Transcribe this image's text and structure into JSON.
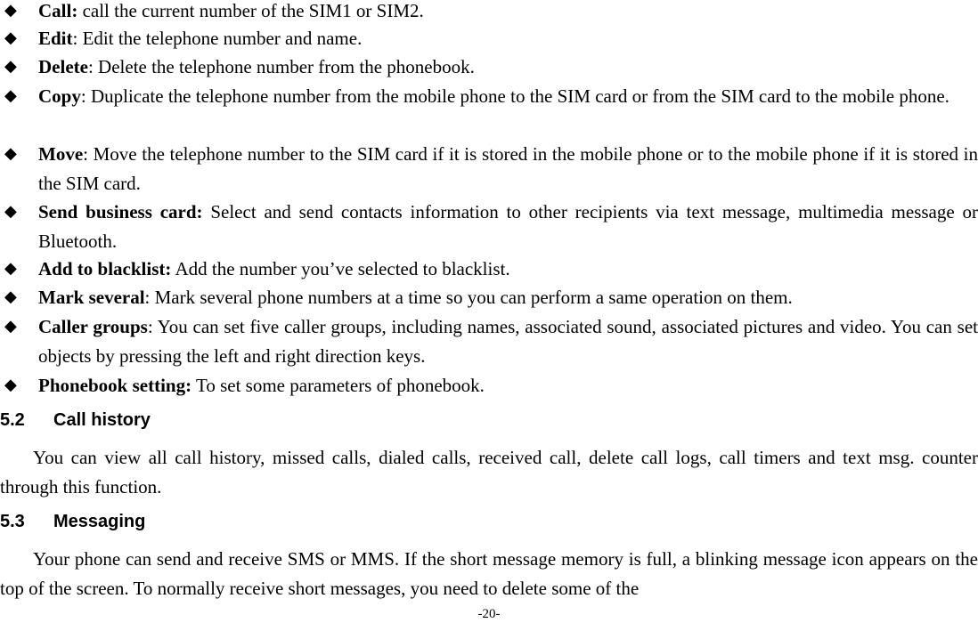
{
  "bullets": [
    {
      "term": "Call:",
      "desc": " call the current number of the SIM1 or SIM2."
    },
    {
      "term": "Edit",
      "desc": ": Edit the telephone number and name."
    },
    {
      "term": "Delete",
      "desc": ": Delete the telephone number from the phonebook."
    },
    {
      "term": "Copy",
      "desc": ": Duplicate the telephone number from the mobile phone to the SIM card or from the SIM card to the mobile phone."
    },
    {
      "term": "Move",
      "desc": ": Move the telephone number to the SIM card if it is stored in the mobile phone or to the mobile phone if it is stored in the SIM card."
    },
    {
      "term": "Send business card:",
      "desc": " Select and send contacts information to other recipients via text message, multimedia message or Bluetooth."
    },
    {
      "term": "Add to blacklist:",
      "desc": " Add the number you’ve selected to blacklist."
    },
    {
      "term": "Mark several",
      "desc": ": Mark several phone numbers at a time so you can perform a same operation on them."
    },
    {
      "term": "Caller groups",
      "desc": ": You can set five caller groups, including names, associated sound, associated pictures and video. You can set objects by pressing the left and right direction keys."
    },
    {
      "term": "Phonebook setting:",
      "desc": " To set some parameters of phonebook."
    }
  ],
  "sections": [
    {
      "number": "5.2",
      "title": "Call history",
      "body": "You can view all call history, missed calls, dialed calls, received call, delete call logs, call timers and text msg. counter through this function."
    },
    {
      "number": "5.3",
      "title": "Messaging",
      "body": "Your phone can send and receive SMS or MMS. If the short message memory is full, a blinking message icon appears on the top of the screen. To normally receive short messages, you need to delete some of the"
    }
  ],
  "footer": {
    "page_number": "-20-"
  },
  "icons": {
    "bullet": "black-diamond-icon"
  }
}
